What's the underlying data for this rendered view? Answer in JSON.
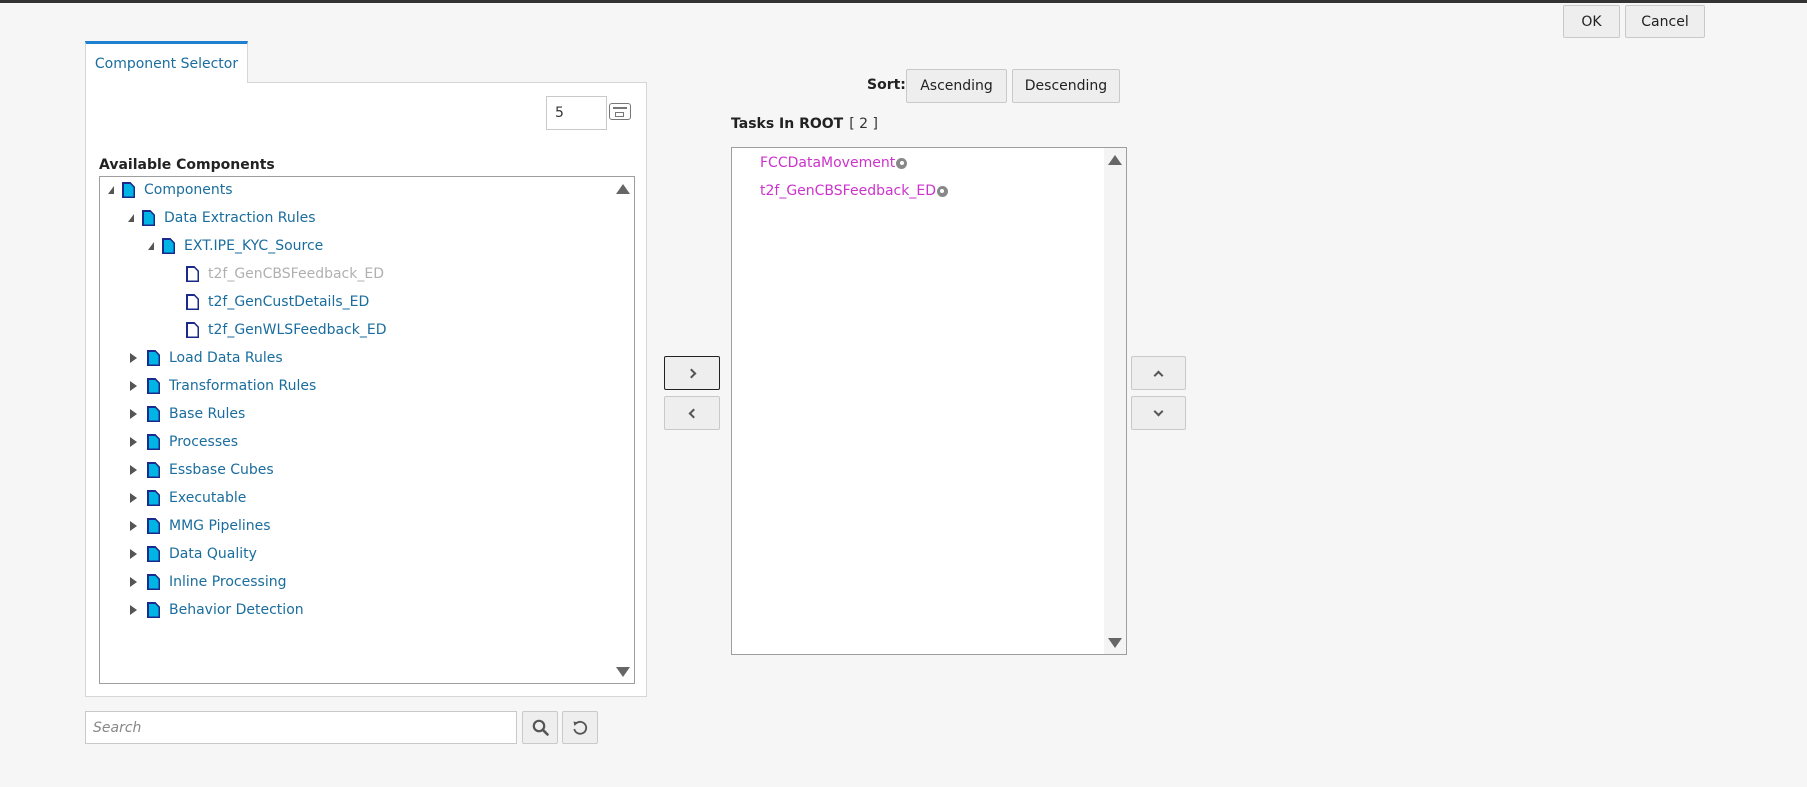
{
  "dialog": {
    "ok_label": "OK",
    "cancel_label": "Cancel"
  },
  "selector": {
    "tab_label": "Component Selector",
    "count_value": "5",
    "available_title": "Available Components",
    "search_placeholder": "Search"
  },
  "tree": [
    {
      "label": "Components",
      "state": "expanded",
      "kind": "folder",
      "level": 0,
      "disabled": false
    },
    {
      "label": "Data Extraction Rules",
      "state": "expanded",
      "kind": "folder",
      "level": 1,
      "disabled": false
    },
    {
      "label": "EXT.IPE_KYC_Source",
      "state": "expanded",
      "kind": "folder",
      "level": 2,
      "disabled": false
    },
    {
      "label": "t2f_GenCBSFeedback_ED",
      "state": "leaf",
      "kind": "leaf",
      "level": 3,
      "disabled": true
    },
    {
      "label": "t2f_GenCustDetails_ED",
      "state": "leaf",
      "kind": "leaf",
      "level": 3,
      "disabled": false
    },
    {
      "label": "t2f_GenWLSFeedback_ED",
      "state": "leaf",
      "kind": "leaf",
      "level": 3,
      "disabled": false
    },
    {
      "label": "Load Data Rules",
      "state": "collapsed",
      "kind": "folder",
      "level": 1,
      "disabled": false
    },
    {
      "label": "Transformation Rules",
      "state": "collapsed",
      "kind": "folder",
      "level": 1,
      "disabled": false
    },
    {
      "label": "Base Rules",
      "state": "collapsed",
      "kind": "folder",
      "level": 1,
      "disabled": false
    },
    {
      "label": "Processes",
      "state": "collapsed",
      "kind": "folder",
      "level": 1,
      "disabled": false
    },
    {
      "label": "Essbase Cubes",
      "state": "collapsed",
      "kind": "folder",
      "level": 1,
      "disabled": false
    },
    {
      "label": "Executable",
      "state": "collapsed",
      "kind": "folder",
      "level": 1,
      "disabled": false
    },
    {
      "label": "MMG Pipelines",
      "state": "collapsed",
      "kind": "folder",
      "level": 1,
      "disabled": false
    },
    {
      "label": "Data Quality",
      "state": "collapsed",
      "kind": "folder",
      "level": 1,
      "disabled": false
    },
    {
      "label": "Inline Processing",
      "state": "collapsed",
      "kind": "folder",
      "level": 1,
      "disabled": false
    },
    {
      "label": "Behavior Detection",
      "state": "collapsed",
      "kind": "folder",
      "level": 1,
      "disabled": false
    }
  ],
  "sort": {
    "label": "Sort:",
    "ascending_label": "Ascending",
    "descending_label": "Descending"
  },
  "tasks": {
    "title": "Tasks In ROOT",
    "count": "[ 2 ]",
    "items": [
      "FCCDataMovement",
      "t2f_GenCBSFeedback_ED"
    ]
  },
  "colors": {
    "link": "#1a6d9e",
    "task": "#cc33cc",
    "tab_accent": "#1f7fd1",
    "folder_icon": "#00b4e6"
  }
}
